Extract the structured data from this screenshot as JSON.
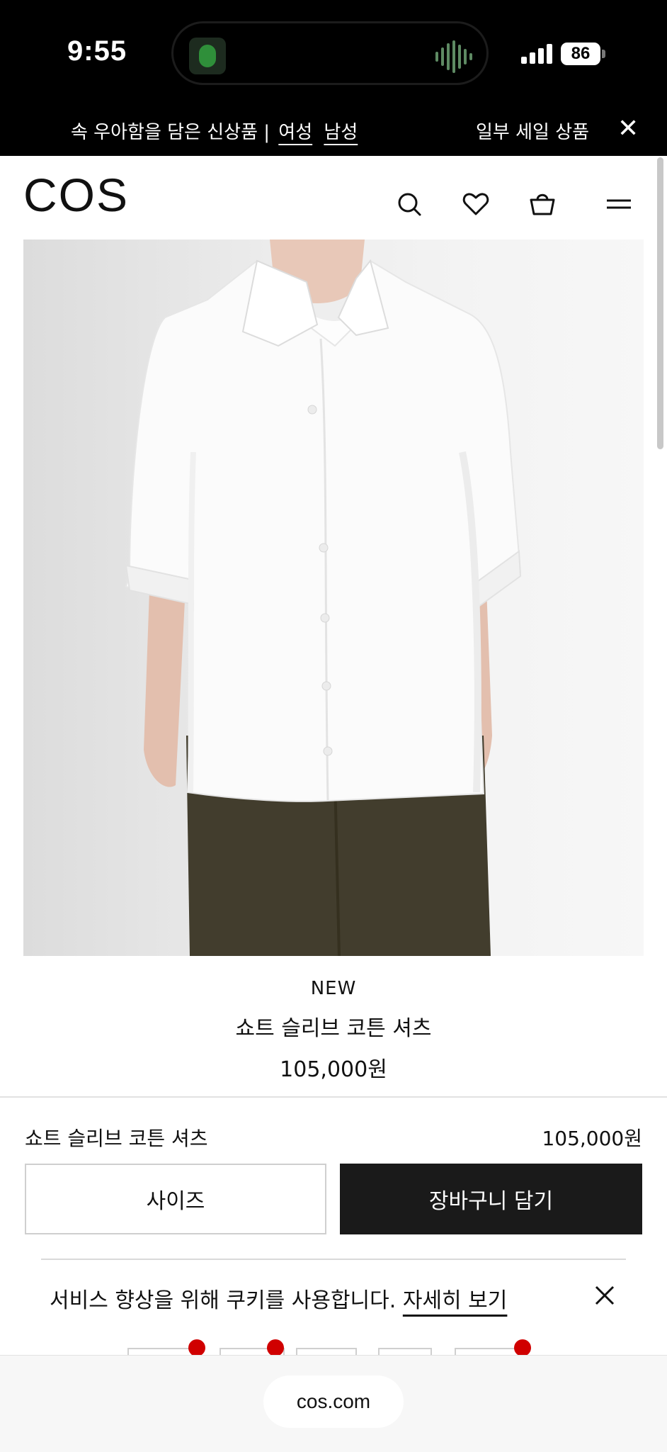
{
  "status_bar": {
    "time": "9:55",
    "battery": "86"
  },
  "promo": {
    "text": "속 우아함을 담은 신상품 |",
    "link_women": "여성",
    "link_men": "남성",
    "sale": "일부 세일 상품",
    "close_icon": "close-icon"
  },
  "header": {
    "logo": "COS",
    "icons": [
      "search-icon",
      "heart-icon",
      "shopping-bag-icon",
      "menu-icon"
    ]
  },
  "product": {
    "badge": "NEW",
    "name": "쇼트 슬리브 코튼 셔츠",
    "price": "105,000원"
  },
  "sticky_bar": {
    "name": "쇼트 슬리브 코튼 셔츠",
    "price": "105,000원",
    "size_button": "사이즈",
    "cart_button": "장바구니 담기"
  },
  "cookie": {
    "text": "서비스 향상을 위해 쿠키를 사용합니다.",
    "link": "자세히 보기"
  },
  "browser": {
    "url": "cos.com"
  },
  "colors": {
    "accent_dark": "#1a1a1a",
    "notification_red": "#d00000"
  }
}
